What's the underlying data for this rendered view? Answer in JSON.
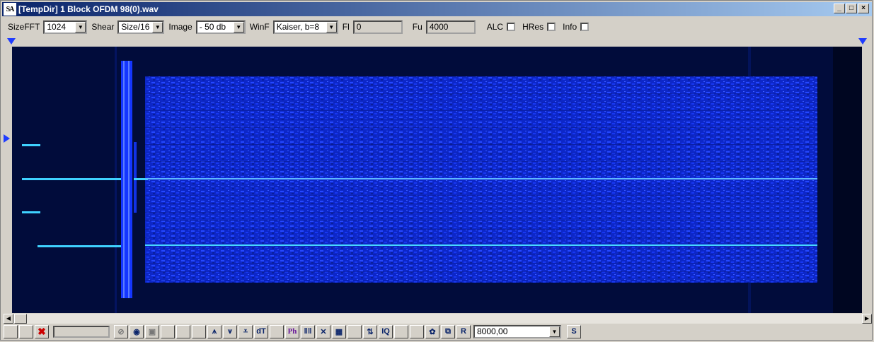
{
  "window": {
    "title": "[TempDir] 1 Block OFDM 98(0).wav",
    "logo_text": "SA",
    "btn_min": "_",
    "btn_max": "□",
    "btn_close": "×"
  },
  "toolbar": {
    "sizefft_label": "SizeFFT",
    "sizefft_value": "1024",
    "shear_label": "Shear",
    "shear_value": "Size/16",
    "image_label": "Image",
    "image_value": "- 50 db",
    "winf_label": "WinF",
    "winf_value": "Kaiser, b=8",
    "fl_label": "Fl",
    "fl_value": "0",
    "fu_label": "Fu",
    "fu_value": "4000",
    "alc_label": "ALC",
    "hres_label": "HRes",
    "info_label": "Info"
  },
  "colors": {
    "spectrogram_bg": "#010c3b",
    "signal": "#1e3cff",
    "tone": "#3fd2ff"
  },
  "bottom": {
    "rate_value": "8000,00",
    "buttons": [
      "stop-icon",
      "speaker-icon",
      "frame-icon",
      "blank",
      "blank",
      "blank",
      "arrow-up-icon",
      "arrow-down-icon",
      "double-down-icon",
      "dT",
      "blank",
      "Ph",
      "bars-icon",
      "cross-icon",
      "grid-icon",
      "blank",
      "updown-icon",
      "IQ",
      "blank",
      "blank",
      "gear-icon",
      "copy-icon",
      "R"
    ],
    "save_button": "S"
  }
}
